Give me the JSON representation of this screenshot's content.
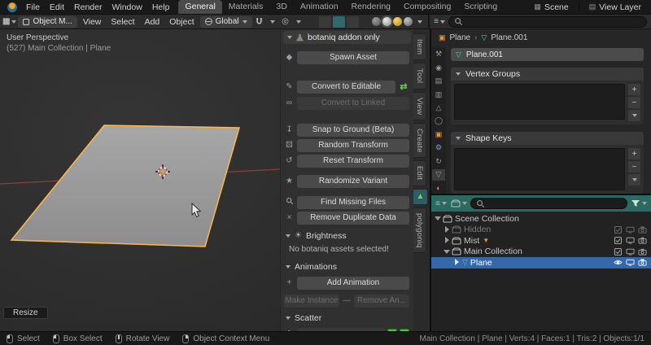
{
  "topbar": {
    "menus": [
      "File",
      "Edit",
      "Render",
      "Window",
      "Help"
    ],
    "workspace_tabs": [
      "General",
      "Materials",
      "3D",
      "Animation",
      "Rendering",
      "Compositing",
      "Scripting"
    ],
    "active_workspace": "General",
    "scene_name": "Scene",
    "view_layer_name": "View Layer"
  },
  "viewport_header": {
    "mode_selector": "Object M...",
    "menus": [
      "View",
      "Select",
      "Add",
      "Object"
    ],
    "orientation": "Global"
  },
  "viewport": {
    "overlay_title": "User Perspective",
    "overlay_subtitle": "(527) Main Collection | Plane",
    "operator_hint": "Resize"
  },
  "botaniq_panel": {
    "header": "botaniq addon only",
    "buttons": {
      "spawn_asset": "Spawn Asset",
      "convert_to_editable": "Convert to Editable",
      "convert_to_linked": "Convert to Linked",
      "snap_to_ground": "Snap to Ground (Beta)",
      "random_transform": "Random Transform",
      "reset_transform": "Reset Transform",
      "randomize_variant": "Randomize Variant",
      "find_missing_files": "Find Missing Files",
      "remove_duplicate_data": "Remove Duplicate Data",
      "add_animation": "Add Animation",
      "make_instance": "Make Instance",
      "remove_animation": "Remove An..."
    },
    "sections": {
      "brightness": "Brightness",
      "animations": "Animations",
      "scatter": "Scatter"
    },
    "messages": {
      "no_assets": "No botaniq assets selected!"
    },
    "separator": "—"
  },
  "sidebar_tabs": {
    "tabs": [
      "Item",
      "Tool",
      "View",
      "Create",
      "Edit"
    ],
    "addon_tab": "polygoniq"
  },
  "properties_panel": {
    "breadcrumb": {
      "object": "Plane",
      "separator": "›",
      "data": "Plane.001"
    },
    "data_name_field": "Plane.001",
    "vertex_groups_header": "Vertex Groups",
    "shape_keys_header": "Shape Keys"
  },
  "prop_tab_icons": [
    "⚒",
    "◉",
    "▤",
    "▥",
    "△",
    "◯",
    "▣",
    "⚙",
    "↻",
    "▽",
    "◐"
  ],
  "outliner": {
    "rows": [
      {
        "label": "Scene Collection"
      },
      {
        "label": "Hidden"
      },
      {
        "label": "Mist"
      },
      {
        "label": "Main Collection"
      },
      {
        "label": "Plane"
      }
    ]
  },
  "status_bar": {
    "hints": [
      "Select",
      "Box Select",
      "Rotate View",
      "Object Context Menu"
    ],
    "stats": "Main Collection | Plane | Verts:4 | Faces:1 | Tris:2 | Objects:1/1"
  },
  "icons": {
    "scene_box": "▦",
    "layers": "▤",
    "editor_grid": "▦",
    "editor_list": "≡",
    "proportional": "◎",
    "sun": "☀",
    "die": "⚄",
    "reset_arrow": "↺",
    "snap_arrow": "↧",
    "star": "★",
    "close_x": "×",
    "pencil": "✎",
    "link_infinity": "∞",
    "swap_arrows": "⇄",
    "asset_diamond": "◆",
    "plus": "+",
    "minus": "−",
    "mesh_triangle": "▽",
    "object_square": "▣",
    "badge_triangle": "▼"
  },
  "colors": {
    "selection_blue": "#3468a8",
    "active_outline": "#ffb648",
    "outliner_header_teal": "#2a6b61",
    "addon_green": "#63c84a",
    "object_orange": "#e8923a",
    "mesh_green": "#4fd1a5"
  }
}
